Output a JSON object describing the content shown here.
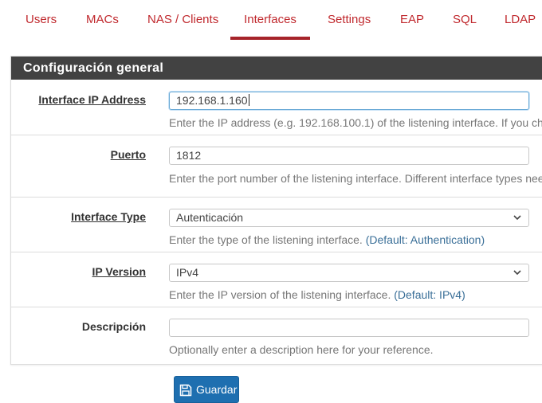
{
  "tabs": [
    {
      "label": "Users",
      "active": false
    },
    {
      "label": "MACs",
      "active": false
    },
    {
      "label": "NAS / Clients",
      "active": false
    },
    {
      "label": "Interfaces",
      "active": true
    },
    {
      "label": "Settings",
      "active": false
    },
    {
      "label": "EAP",
      "active": false
    },
    {
      "label": "SQL",
      "active": false
    },
    {
      "label": "LDAP",
      "active": false
    }
  ],
  "panel": {
    "title": "Configuración general",
    "fields": {
      "ip_address": {
        "label": "Interface IP Address",
        "value": "192.168.1.160",
        "help": "Enter the IP address (e.g. 192.168.100.1) of the listening interface. If you ch"
      },
      "port": {
        "label": "Puerto",
        "value": "1812",
        "help": "Enter the port number of the listening interface. Different interface types nee"
      },
      "interface_type": {
        "label": "Interface Type",
        "selected": "Autenticación",
        "help": "Enter the type of the listening interface.",
        "default": "(Default: Authentication)"
      },
      "ip_version": {
        "label": "IP Version",
        "selected": "IPv4",
        "help": "Enter the IP version of the listening interface.",
        "default": "(Default: IPv4)"
      },
      "description": {
        "label": "Descripción",
        "value": "",
        "help": "Optionally enter a description here for your reference."
      }
    }
  },
  "actions": {
    "save_label": "Guardar",
    "save_icon": "floppy-disk-icon"
  },
  "colors": {
    "tab_text": "#c0282d",
    "tab_active_underline": "#a6242a",
    "panel_heading_bg": "#424242",
    "help_default": "#3a6f98",
    "save_button_bg": "#1e6fb0"
  }
}
